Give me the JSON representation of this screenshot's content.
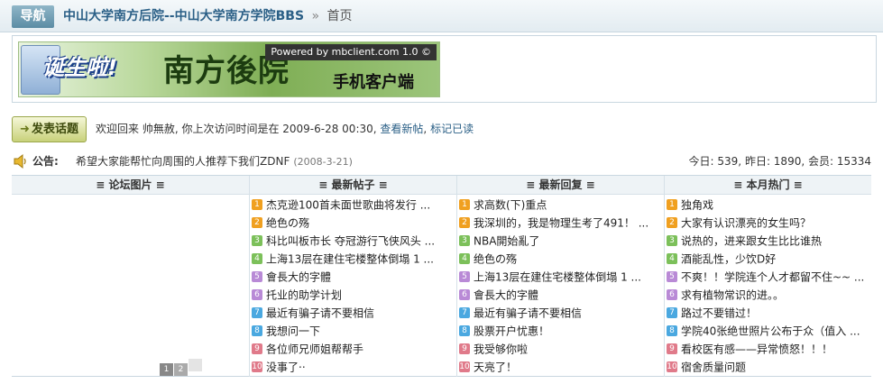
{
  "nav": {
    "tag": "导航",
    "forum_name": "中山大学南方后院--中山大学南方学院BBS",
    "separator": "»",
    "home": "首页"
  },
  "banner": {
    "slogan": "诞生啦!",
    "name": "南方後院",
    "powered": "Powered by mbclient.com 1.0 ©",
    "client_label": "手机客户端"
  },
  "post_button": {
    "label": "发表话题"
  },
  "welcome": {
    "text": "欢迎回来  帅無赦, 你上次访问时间是在  2009-6-28 00:30,",
    "link_new": "查看新帖",
    "link_mark": "标记已读"
  },
  "announcement": {
    "label": "公告:",
    "text": "希望大家能帮忙向周围的人推荐下我们ZDNF",
    "date": "(2008-3-21)"
  },
  "stats": "今日: 539, 昨日: 1890, 会员: 15334",
  "columns": {
    "images": "≡ 论坛图片 ≡",
    "latest_posts": "≡ 最新帖子 ≡",
    "latest_replies": "≡ 最新回复 ≡",
    "monthly_hot": "≡ 本月热门 ≡"
  },
  "rank_colors": [
    "#f0a020",
    "#f0a020",
    "#7cc05a",
    "#7cc05a",
    "#b98ad6",
    "#b98ad6",
    "#4aa8e0",
    "#4aa8e0",
    "#e07a8a",
    "#e07a8a"
  ],
  "latest_posts": [
    {
      "n": "1",
      "t": "杰克逊100首未面世歌曲将发行 ..."
    },
    {
      "n": "2",
      "t": "绝色の殇"
    },
    {
      "n": "3",
      "t": "科比叫板市长 夺冠游行飞侠风头 ..."
    },
    {
      "n": "4",
      "t": "上海13层在建住宅楼整体倒塌 1 ..."
    },
    {
      "n": "5",
      "t": "會長大的字體"
    },
    {
      "n": "6",
      "t": "托业的助学计划"
    },
    {
      "n": "7",
      "t": "最近有骗子请不要相信"
    },
    {
      "n": "8",
      "t": "我想问一下"
    },
    {
      "n": "9",
      "t": "各位师兄师姐帮帮手"
    },
    {
      "n": "10",
      "t": "没事了··"
    }
  ],
  "latest_replies": [
    {
      "n": "1",
      "t": "求高数(下)重点"
    },
    {
      "n": "2",
      "t": "我深圳的，我是物理生考了491！ ..."
    },
    {
      "n": "3",
      "t": "NBA開始亂了"
    },
    {
      "n": "4",
      "t": "绝色の殇"
    },
    {
      "n": "5",
      "t": "上海13层在建住宅楼整体倒塌 1 ..."
    },
    {
      "n": "6",
      "t": "會長大的字體"
    },
    {
      "n": "7",
      "t": "最近有骗子请不要相信"
    },
    {
      "n": "8",
      "t": "股票开户忧惠！"
    },
    {
      "n": "9",
      "t": "我受够你啦"
    },
    {
      "n": "10",
      "t": "天亮了！"
    }
  ],
  "monthly_hot": [
    {
      "n": "1",
      "t": "独角戏"
    },
    {
      "n": "2",
      "t": "大家有认识漂亮的女生吗？"
    },
    {
      "n": "3",
      "t": "说热的，进来跟女生比比谁热"
    },
    {
      "n": "4",
      "t": "酒能乱性，少饮D好"
    },
    {
      "n": "5",
      "t": "不爽！！学院连个人才都留不住~~ ..."
    },
    {
      "n": "6",
      "t": "求有植物常识的进。。"
    },
    {
      "n": "7",
      "t": "路过不要错过！"
    },
    {
      "n": "8",
      "t": "学院40张绝世照片公布于众（值入 ..."
    },
    {
      "n": "9",
      "t": "看校医有感——异常愤怒！！！"
    },
    {
      "n": "10",
      "t": "宿舍质量问题"
    }
  ],
  "pager": [
    "1",
    "2",
    ""
  ]
}
